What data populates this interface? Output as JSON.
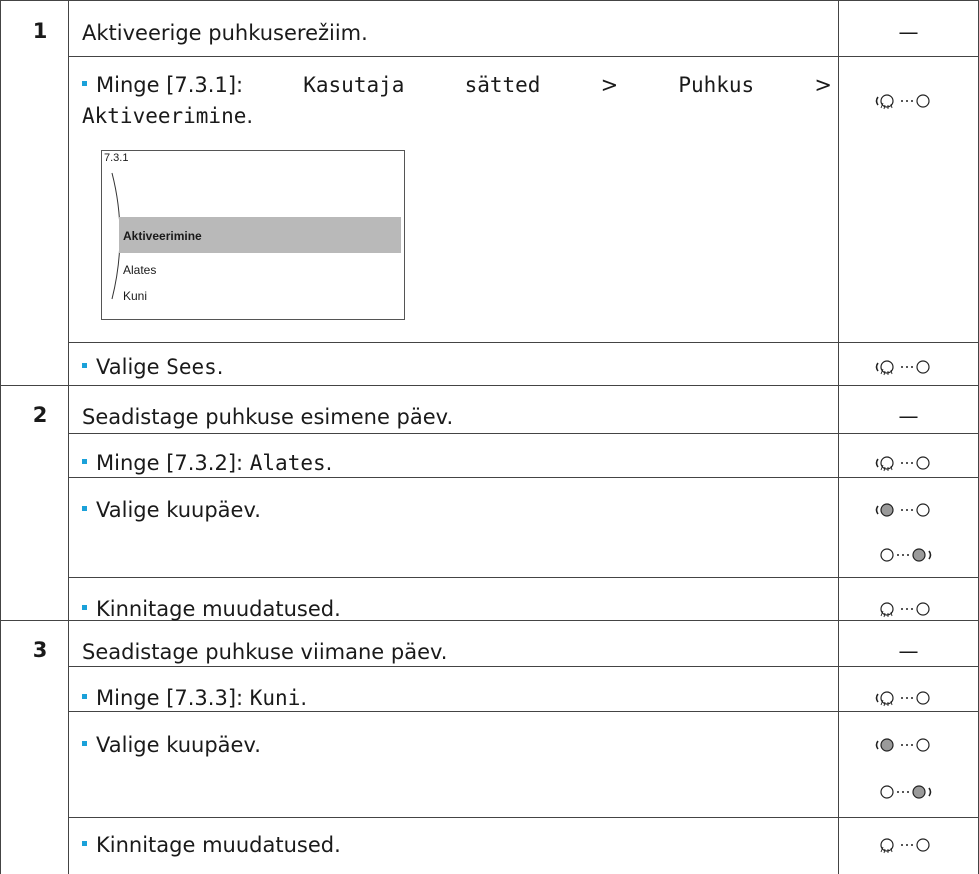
{
  "steps": [
    {
      "num": "1",
      "title": "Aktiveerige puhkuserežiim.",
      "dash": "—"
    },
    {
      "num": "2",
      "title": "Seadistage puhkuse esimene päev.",
      "dash": "—"
    },
    {
      "num": "3",
      "title": "Seadistage puhkuse viimane päev.",
      "dash": "—"
    }
  ],
  "s1": {
    "goto_pre": "Minge [7.3.1]: ",
    "goto_path1": "Kasutaja",
    "goto_path2": "sätted",
    "goto_sep1": ">",
    "goto_path3": "Puhkus",
    "goto_sep2": ">",
    "goto_path4": "Aktiveerimine",
    "goto_end": ".",
    "select_pre": "Valige ",
    "select_val": "Sees",
    "select_end": "."
  },
  "screen": {
    "header": "7.3.1",
    "selected": "Aktiveerimine",
    "items": [
      "Alates",
      "Kuni"
    ]
  },
  "s2": {
    "goto_pre": "Minge [7.3.2]: ",
    "goto_val": "Alates",
    "goto_end": ".",
    "date": "Valige kuupäev.",
    "confirm": "Kinnitage muudatused."
  },
  "s3": {
    "goto_pre": "Minge [7.3.3]: ",
    "goto_val": "Kuni",
    "goto_end": ".",
    "date": "Valige kuupäev.",
    "confirm": "Kinnitage muudatused."
  },
  "icons": {
    "accent": "#1ba1d9",
    "turn_push": "dial-turn-push-icon",
    "turn_left": "left-dial-turn-icon",
    "turn_right": "right-dial-turn-icon",
    "push": "dial-push-icon"
  }
}
